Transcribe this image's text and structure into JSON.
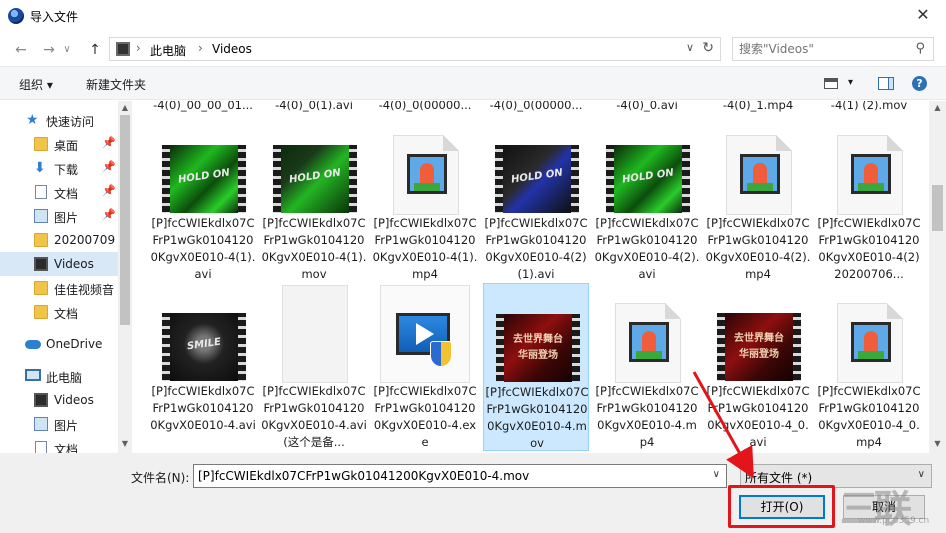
{
  "window": {
    "title": "导入文件",
    "close_glyph": "✕"
  },
  "address": {
    "back_glyph": "←",
    "forward_glyph": "→",
    "up_glyph": "↑",
    "crumbs": [
      "此电脑",
      "Videos"
    ],
    "separator": "›",
    "dropdown_glyph": "∨",
    "refresh_glyph": "↻"
  },
  "search": {
    "placeholder": "搜索\"Videos\"",
    "icon": "search-icon"
  },
  "toolbar": {
    "organize_label": "组织 ▾",
    "new_folder_label": "新建文件夹",
    "view_dropdown_glyph": "▾",
    "help_glyph": "?"
  },
  "nav": {
    "items": [
      {
        "label": "快速访问",
        "icon": "star-icon"
      },
      {
        "label": "桌面",
        "icon": "folder-icon",
        "pinned": true
      },
      {
        "label": "下载",
        "icon": "download-icon",
        "pinned": true
      },
      {
        "label": "文档",
        "icon": "document-icon",
        "pinned": true
      },
      {
        "label": "图片",
        "icon": "picture-icon",
        "pinned": true
      },
      {
        "label": "20200709",
        "icon": "folder-icon"
      },
      {
        "label": "Videos",
        "icon": "video-folder-icon",
        "selected": true
      },
      {
        "label": "佳佳视频音",
        "icon": "folder-icon"
      },
      {
        "label": "文档",
        "icon": "folder-icon"
      },
      {
        "label": "OneDrive",
        "icon": "cloud-icon"
      },
      {
        "label": "此电脑",
        "icon": "computer-icon"
      },
      {
        "label": "Videos",
        "icon": "video-folder-icon"
      },
      {
        "label": "图片",
        "icon": "picture-icon"
      },
      {
        "label": "文档",
        "icon": "document-icon"
      }
    ],
    "pin_glyph": "📌"
  },
  "files": {
    "prev_row": [
      "-4(0)_00_00_01...",
      "-4(0)_0(1).avi",
      "-4(0)_0(00000...",
      "-4(0)_0(00000...",
      "-4(0)_0.avi",
      "-4(0)_1.mp4",
      "-4(1) (2).mov"
    ],
    "row1": [
      {
        "name": "[P]fcCWIEkdlx07CFrP1wGk01041200KgvX0E010-4(1).avi",
        "thumb": "video-green",
        "caption": "HOLD ON"
      },
      {
        "name": "[P]fcCWIEkdlx07CFrP1wGk01041200KgvX0E010-4(1).mov",
        "thumb": "video-green2",
        "caption": "HOLD ON"
      },
      {
        "name": "[P]fcCWIEkdlx07CFrP1wGk01041200KgvX0E010-4(1).mp4",
        "thumb": "media-file"
      },
      {
        "name": "[P]fcCWIEkdlx07CFrP1wGk01041200KgvX0E010-4(2)(1).avi",
        "thumb": "video-blue",
        "caption": "HOLD ON"
      },
      {
        "name": "[P]fcCWIEkdlx07CFrP1wGk01041200KgvX0E010-4(2).avi",
        "thumb": "video-green",
        "caption": "HOLD ON"
      },
      {
        "name": "[P]fcCWIEkdlx07CFrP1wGk01041200KgvX0E010-4(2).mp4",
        "thumb": "media-file"
      },
      {
        "name": "[P]fcCWIEkdlx07CFrP1wGk01041200KgvX0E010-4(2)20200706...",
        "thumb": "media-file"
      }
    ],
    "row2": [
      {
        "name": "[P]fcCWIEkdlx07CFrP1wGk01041200KgvX0E010-4.avi",
        "thumb": "video-dark",
        "caption": "SMILE"
      },
      {
        "name": "[P]fcCWIEkdlx07CFrP1wGk01041200KgvX0E010-4.avi(这个是备...",
        "thumb": "blank-file"
      },
      {
        "name": "[P]fcCWIEkdlx07CFrP1wGk01041200KgvX0E010-4.exe",
        "thumb": "exe-file"
      },
      {
        "name": "[P]fcCWIEkdlx07CFrP1wGk01041200KgvX0E010-4.mov",
        "thumb": "video-red",
        "caption": "去世界舞台 华丽登场",
        "selected": true
      },
      {
        "name": "[P]fcCWIEkdlx07CFrP1wGk01041200KgvX0E010-4.mp4",
        "thumb": "media-file"
      },
      {
        "name": "[P]fcCWIEkdlx07CFrP1wGk01041200KgvX0E010-4_0.avi",
        "thumb": "video-red",
        "caption": "去世界舞台 华丽登场"
      },
      {
        "name": "[P]fcCWIEkdlx07CFrP1wGk01041200KgvX0E010-4_0.mp4",
        "thumb": "media-file"
      }
    ]
  },
  "bottom": {
    "filename_label": "文件名(N):",
    "filename_value": "[P]fcCWIEkdlx07CFrP1wGk01041200KgvX0E010-4.mov",
    "filetype_value": "所有文件 (*)",
    "open_label": "打开(O)",
    "cancel_label": "取消",
    "dropdown_glyph": "∨"
  },
  "annotation": {
    "color": "#e4141b"
  },
  "watermark": {
    "logo_text": "三联",
    "url": "www.pc0359.cn"
  },
  "scroll_glyphs": {
    "up": "▲",
    "down": "▼"
  }
}
